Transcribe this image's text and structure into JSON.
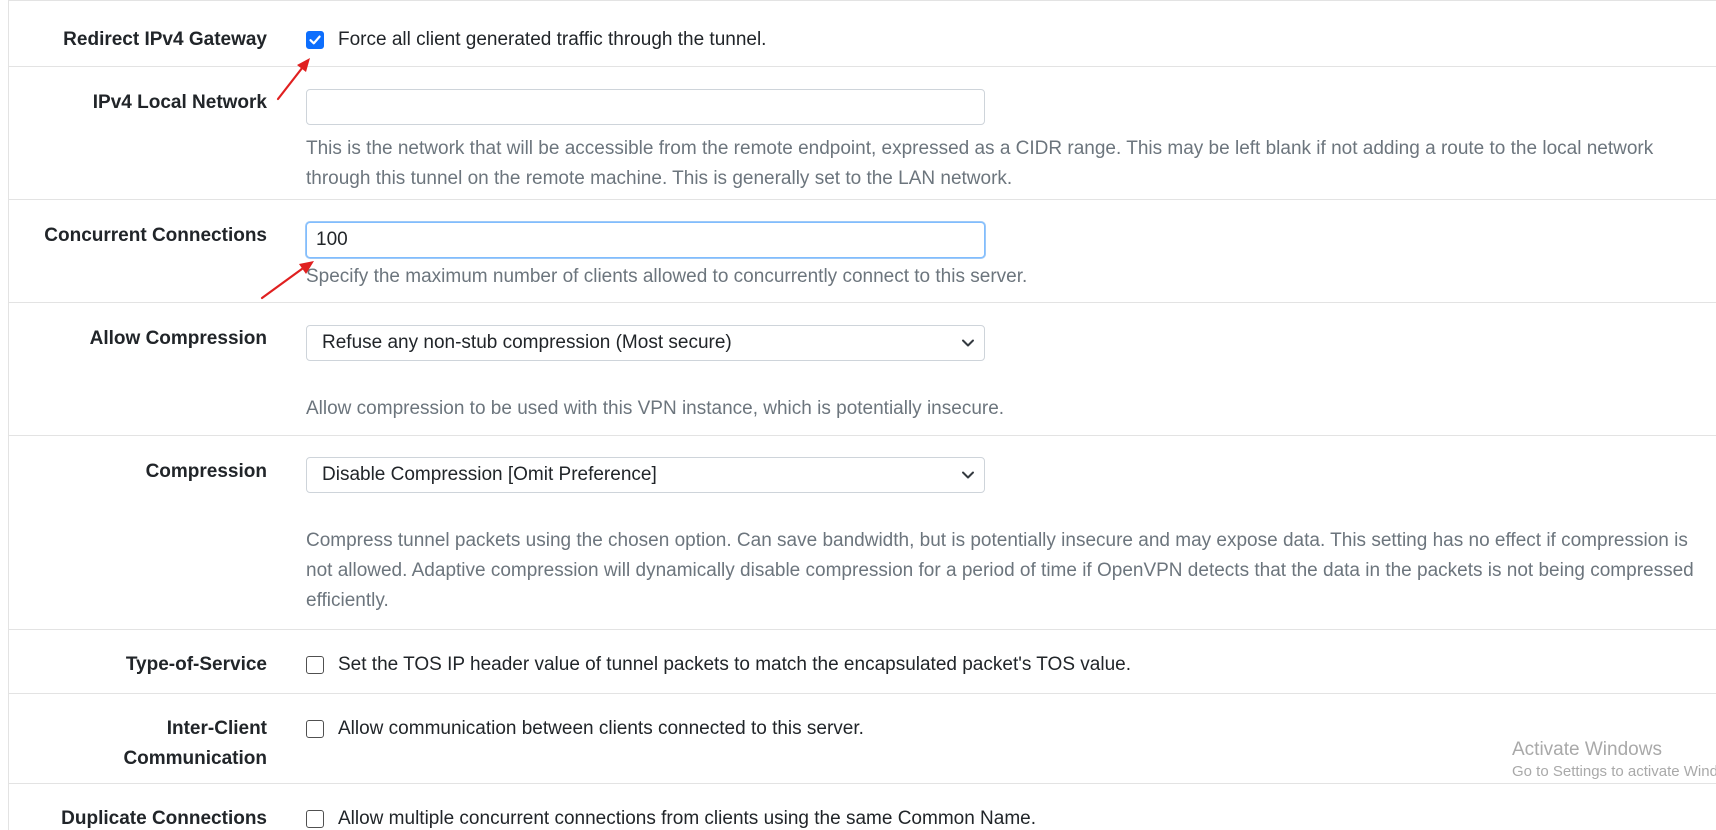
{
  "rows": {
    "redirect_gateway": {
      "label": "Redirect IPv4 Gateway",
      "checkbox_checked": true,
      "checkbox_text": "Force all client generated traffic through the tunnel."
    },
    "local_network": {
      "label": "IPv4 Local Network",
      "value": "",
      "help": "This is the network that will be accessible from the remote endpoint, expressed as a CIDR range. This may be left blank if not adding a route to the local network through this tunnel on the remote machine. This is generally set to the LAN network."
    },
    "concurrent": {
      "label": "Concurrent Connections",
      "value": "100",
      "help": "Specify the maximum number of clients allowed to concurrently connect to this server."
    },
    "allow_compression": {
      "label": "Allow Compression",
      "selected": "Refuse any non-stub compression (Most secure)",
      "help": "Allow compression to be used with this VPN instance, which is potentially insecure."
    },
    "compression": {
      "label": "Compression",
      "selected": "Disable Compression [Omit Preference]",
      "help": "Compress tunnel packets using the chosen option. Can save bandwidth, but is potentially insecure and may expose data. This setting has no effect if compression is not allowed. Adaptive compression will dynamically disable compression for a period of time if OpenVPN detects that the data in the packets is not being compressed efficiently."
    },
    "tos": {
      "label": "Type-of-Service",
      "checkbox_checked": false,
      "checkbox_text": "Set the TOS IP header value of tunnel packets to match the encapsulated packet's TOS value."
    },
    "inter_client": {
      "label_line1": "Inter-Client",
      "label_line2": "Communication",
      "checkbox_checked": false,
      "checkbox_text": "Allow communication between clients connected to this server."
    },
    "duplicate": {
      "label": "Duplicate Connections",
      "checkbox_checked": false,
      "checkbox_text": "Allow multiple concurrent connections from clients using the same Common Name."
    }
  },
  "watermark": {
    "line1": "Activate Windows",
    "line2": "Go to Settings to activate Windows."
  },
  "colors": {
    "accent": "#0d6efd",
    "annotation_arrow": "#e02020",
    "help_text": "#6c757d"
  },
  "icons": {
    "checkmark": "check-icon",
    "dropdown": "chevron-down-icon",
    "annotation": "red-arrow-icon"
  }
}
